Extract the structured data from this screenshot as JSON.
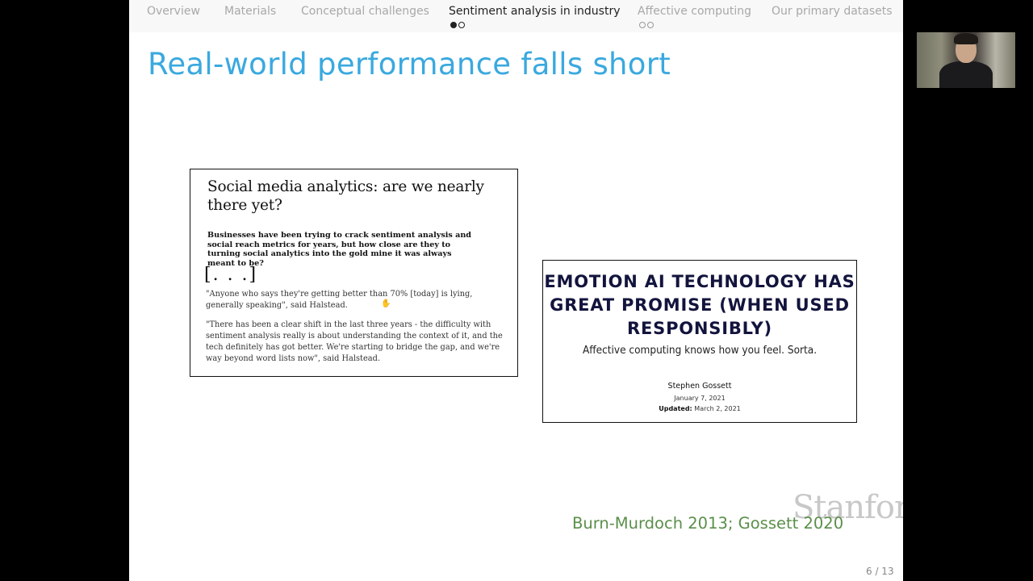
{
  "nav": {
    "sections": [
      {
        "label": "Overview"
      },
      {
        "label": "Materials"
      },
      {
        "label": "Conceptual challenges"
      },
      {
        "label": "Sentiment analysis in industry"
      },
      {
        "label": "Affective computing"
      },
      {
        "label": "Our primary datasets"
      }
    ]
  },
  "slide": {
    "title": "Real-world performance falls short",
    "left_article": {
      "headline": "Social media analytics: are we nearly there yet?",
      "standfirst": "Businesses have been trying to crack sentiment analysis and social reach metrics for years, but how close are they to turning social analytics into the gold mine it was always meant to be?",
      "ellipsis": "[. . .]",
      "quote1": "\"Anyone who says they're getting better than 70% [today] is lying, generally speaking\", said Halstead.",
      "quote2": "\"There has been a clear shift in the last three years - the difficulty with sentiment analysis really is about understanding the context of it, and the tech definitely has got better. We're starting to bridge the gap, and we're way beyond word lists now\", said Halstead."
    },
    "right_article": {
      "headline": "EMOTION AI TECHNOLOGY HAS GREAT PROMISE (WHEN USED RESPONSIBLY)",
      "subheadline": "Affective computing knows how you feel. Sorta.",
      "author": "Stephen Gossett",
      "date": "January 7, 2021",
      "updated_label": "Updated:",
      "updated_date": "March 2, 2021"
    },
    "watermark": "Stanford",
    "citation": "Burn-Murdoch 2013; Gossett 2020",
    "page_number": "6 / 13"
  },
  "colors": {
    "title": "#3aa9df",
    "citation": "#5a8f4a",
    "right_headline": "#13143d"
  }
}
